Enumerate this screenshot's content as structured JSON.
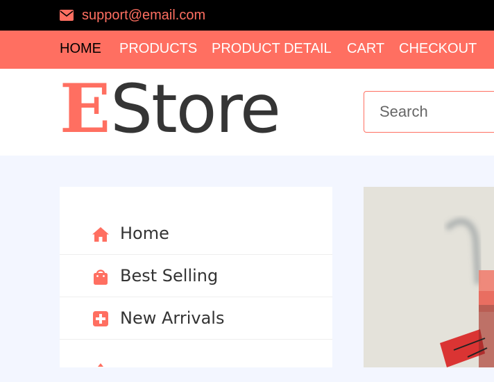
{
  "topbar": {
    "email": "support@email.com",
    "email_icon": "envelope-icon",
    "accent_color": "#ff6f61"
  },
  "nav": {
    "items": [
      {
        "label": "HOME",
        "active": true
      },
      {
        "label": "PRODUCTS"
      },
      {
        "label": "PRODUCT DETAIL"
      },
      {
        "label": "CART"
      },
      {
        "label": "CHECKOUT"
      }
    ],
    "bar_color": "#ff6f61"
  },
  "header": {
    "logo_initial": "E",
    "logo_rest": "Store",
    "search_placeholder": "Search"
  },
  "sidebar": {
    "items": [
      {
        "label": "Home",
        "icon": "home-icon"
      },
      {
        "label": "Best Selling",
        "icon": "shopping-bag-icon"
      },
      {
        "label": "New Arrivals",
        "icon": "plus-square-icon"
      }
    ]
  },
  "banner": {
    "image": "shopping-cart-photo"
  }
}
